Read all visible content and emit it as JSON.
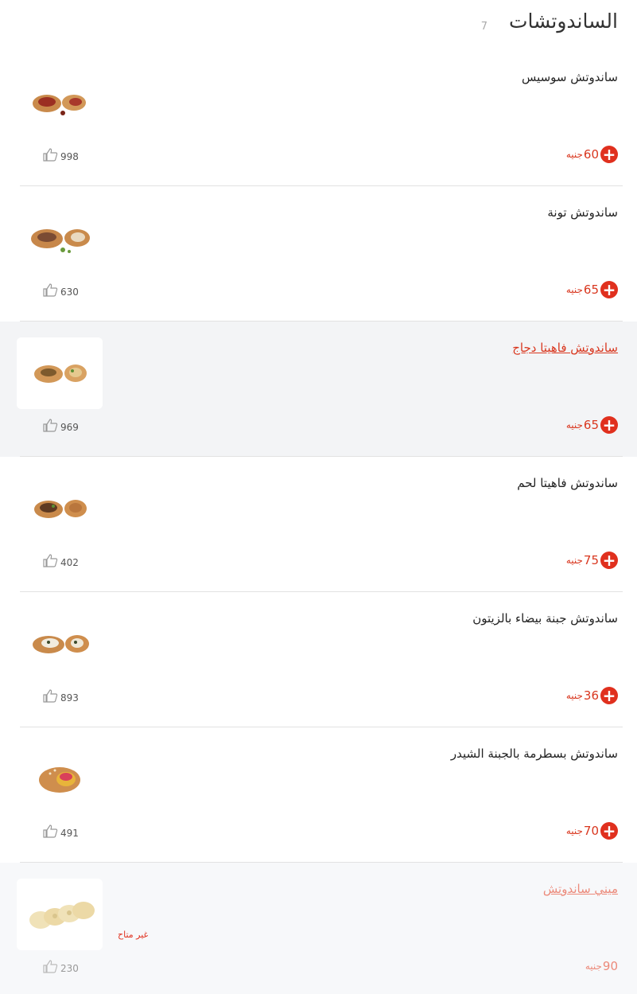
{
  "section": {
    "title": "الساندوتشات",
    "count": "7"
  },
  "colors": {
    "accent": "#e0301e",
    "highlight_bg": "#f3f4f6",
    "divider": "#e2e2e2"
  },
  "items": [
    {
      "name": "ساندوتش سوسيس",
      "price": "60",
      "currency": "جنيه",
      "likes": "998",
      "state": "normal",
      "image": "sausage-sandwich-image"
    },
    {
      "name": "ساندوتش تونة",
      "price": "65",
      "currency": "جنيه",
      "likes": "630",
      "state": "normal",
      "image": "tuna-sandwich-image"
    },
    {
      "name": "ساندوتش فاهيتا دجاج",
      "price": "65",
      "currency": "جنيه",
      "likes": "969",
      "state": "highlight",
      "image": "chicken-fajita-sandwich-image"
    },
    {
      "name": "ساندوتش فاهيتا لحم",
      "price": "75",
      "currency": "جنيه",
      "likes": "402",
      "state": "normal",
      "image": "beef-fajita-sandwich-image"
    },
    {
      "name": "ساندوتش جبنة بيضاء بالزيتون",
      "price": "36",
      "currency": "جنيه",
      "likes": "893",
      "state": "normal",
      "image": "white-cheese-olive-sandwich-image"
    },
    {
      "name": "ساندوتش بسطرمة بالجبنة الشيدر",
      "price": "70",
      "currency": "جنيه",
      "likes": "491",
      "state": "normal",
      "image": "pastrami-cheddar-sandwich-image"
    },
    {
      "name": "ميني ساندوتش",
      "price": "90",
      "currency": "جنيه",
      "likes": "230",
      "state": "unavailable",
      "status": "غير متاح",
      "image": "mini-sandwich-image"
    }
  ]
}
